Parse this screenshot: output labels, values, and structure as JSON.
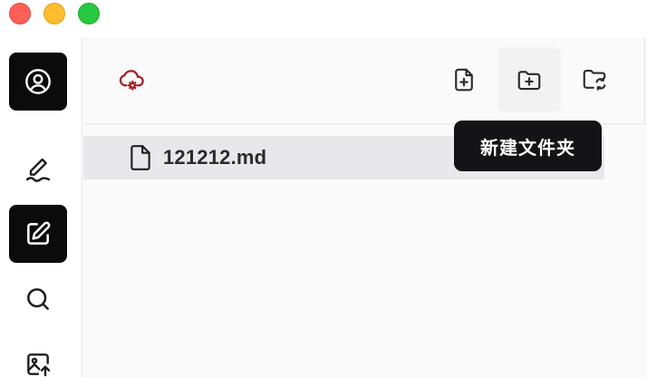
{
  "window": {
    "traffic_lights": [
      "close",
      "minimize",
      "zoom"
    ]
  },
  "sidebar": {
    "items": [
      {
        "icon": "account-icon",
        "active": true
      },
      {
        "icon": "signature-pen-icon",
        "active": false
      },
      {
        "icon": "edit-icon",
        "active": true
      },
      {
        "icon": "search-icon",
        "active": false
      },
      {
        "icon": "image-upload-icon",
        "active": false
      }
    ]
  },
  "toolbar": {
    "sync_icon": "cloud-settings-icon",
    "buttons": [
      {
        "icon": "new-file-icon"
      },
      {
        "icon": "new-folder-icon"
      },
      {
        "icon": "refresh-folder-icon"
      }
    ]
  },
  "files": [
    {
      "name": "121212.md",
      "icon": "file-icon",
      "selected": true
    }
  ],
  "tooltip": {
    "text": "新建文件夹"
  },
  "colors": {
    "accent_dark": "#0b0b0c",
    "cloud_icon": "#a31f24",
    "selected_row": "#e8e8ea",
    "tooltip_bg": "#141416"
  }
}
